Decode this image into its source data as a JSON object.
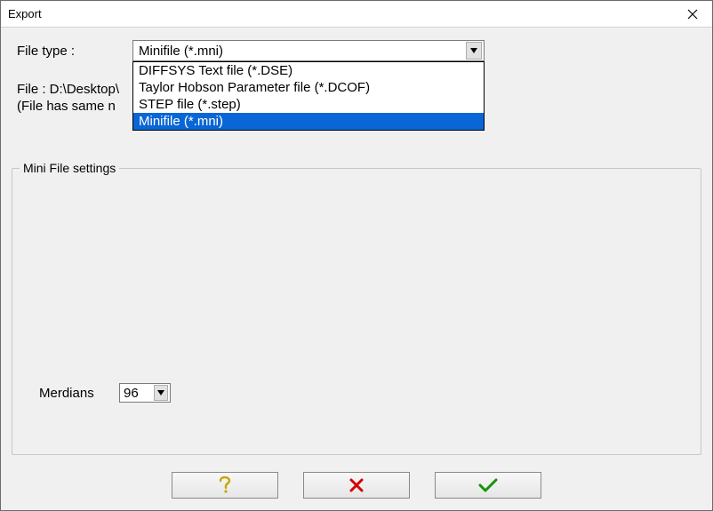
{
  "window": {
    "title": "Export"
  },
  "filetype": {
    "label": "File type :",
    "selected": "Minifile (*.mni)",
    "options": [
      "DIFFSYS Text file (*.DSE)",
      "Taylor Hobson Parameter file (*.DCOF)",
      "STEP file (*.step)",
      "Minifile (*.mni)"
    ],
    "selected_index": 3
  },
  "fileinfo": {
    "line1": "File : D:\\Desktop\\",
    "line2": "(File has same n"
  },
  "groupbox": {
    "title": "Mini File settings"
  },
  "meridians": {
    "label": "Merdians",
    "value": "96"
  },
  "buttons": {
    "help": "help",
    "cancel": "cancel",
    "ok": "ok"
  }
}
